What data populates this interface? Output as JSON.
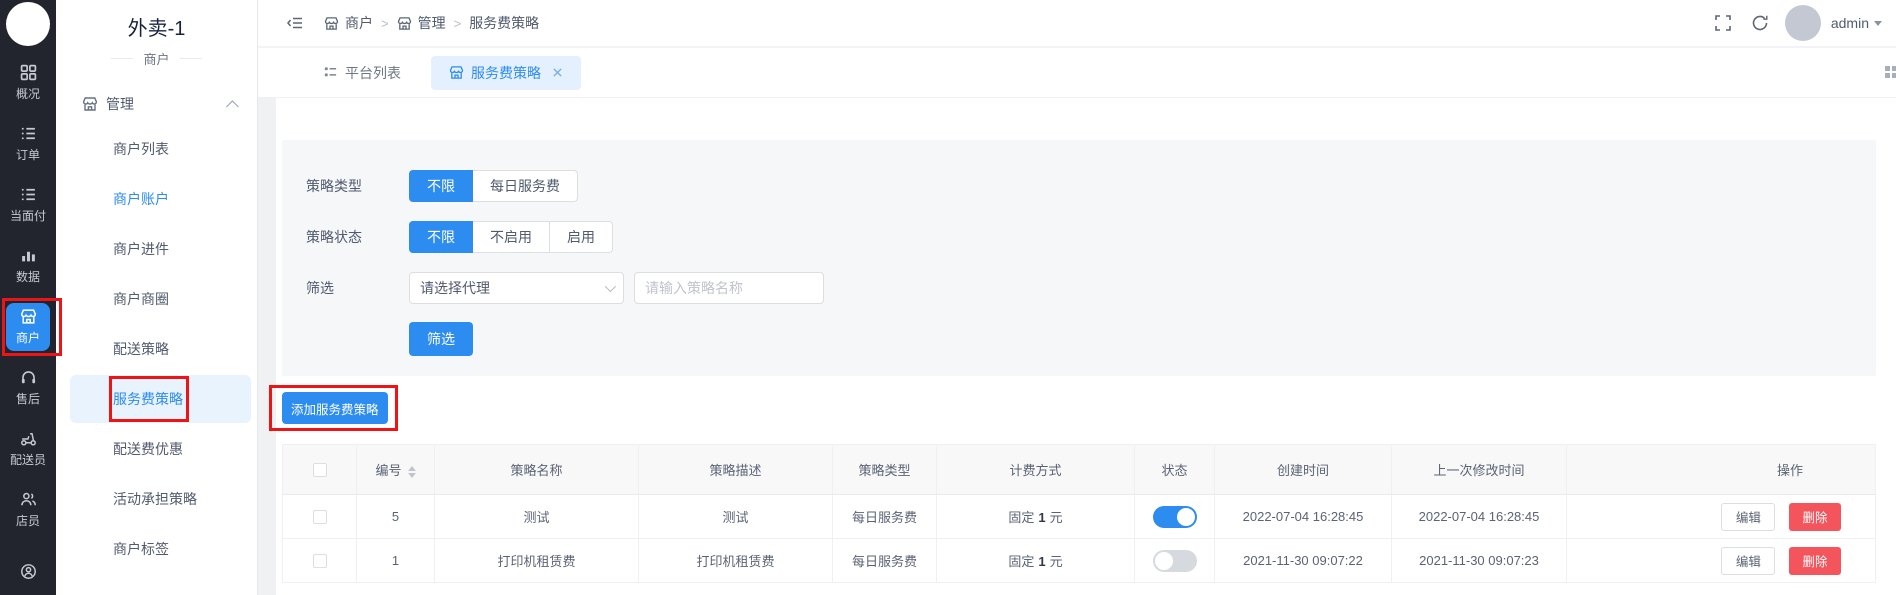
{
  "brand": {
    "title": "外卖-1",
    "subtitle": "商户"
  },
  "rail": {
    "items": [
      {
        "label": "概况"
      },
      {
        "label": "订单"
      },
      {
        "label": "当面付"
      },
      {
        "label": "数据"
      },
      {
        "label": "商户",
        "active": true
      },
      {
        "label": "售后"
      },
      {
        "label": "配送员"
      },
      {
        "label": "店员"
      }
    ]
  },
  "sidebar": {
    "group_label": "管理",
    "items": [
      {
        "label": "商户列表"
      },
      {
        "label": "商户账户",
        "highlighted": true
      },
      {
        "label": "商户进件"
      },
      {
        "label": "商户商圈"
      },
      {
        "label": "配送策略"
      },
      {
        "label": "服务费策略",
        "active": true
      },
      {
        "label": "配送费优惠"
      },
      {
        "label": "活动承担策略"
      },
      {
        "label": "商户标签"
      }
    ]
  },
  "header": {
    "breadcrumb": [
      "商户",
      "管理",
      "服务费策略"
    ],
    "separator": ">",
    "username": "admin"
  },
  "tabs": [
    {
      "label": "平台列表",
      "active": false
    },
    {
      "label": "服务费策略",
      "active": true,
      "closable": true
    }
  ],
  "filter": {
    "type": {
      "label": "策略类型",
      "options": [
        "不限",
        "每日服务费"
      ],
      "selected": "不限"
    },
    "status": {
      "label": "策略状态",
      "options": [
        "不限",
        "不启用",
        "启用"
      ],
      "selected": "不限"
    },
    "search": {
      "label": "筛选",
      "select_placeholder": "请选择代理",
      "input_placeholder": "请输入策略名称",
      "button_label": "筛选"
    }
  },
  "add_button_label": "添加服务费策略",
  "table": {
    "headers": [
      "编号",
      "策略名称",
      "策略描述",
      "策略类型",
      "计费方式",
      "状态",
      "创建时间",
      "上一次修改时间",
      "操作"
    ],
    "rows": [
      {
        "id": "5",
        "name": "测试",
        "desc": "测试",
        "type": "每日服务费",
        "billing": [
          "固定",
          "1",
          "元"
        ],
        "enabled": true,
        "created": "2022-07-04 16:28:45",
        "modified": "2022-07-04 16:28:45"
      },
      {
        "id": "1",
        "name": "打印机租赁费",
        "desc": "打印机租赁费",
        "type": "每日服务费",
        "billing": [
          "固定",
          "1",
          "元"
        ],
        "enabled": false,
        "created": "2021-11-30 09:07:22",
        "modified": "2021-11-30 09:07:23"
      }
    ],
    "edit_label": "编辑",
    "delete_label": "删除"
  },
  "colors": {
    "accent": "#2d8cf0",
    "danger": "#f4545c",
    "annotation": "#ec1414",
    "toggle_off": "#d6dade"
  }
}
